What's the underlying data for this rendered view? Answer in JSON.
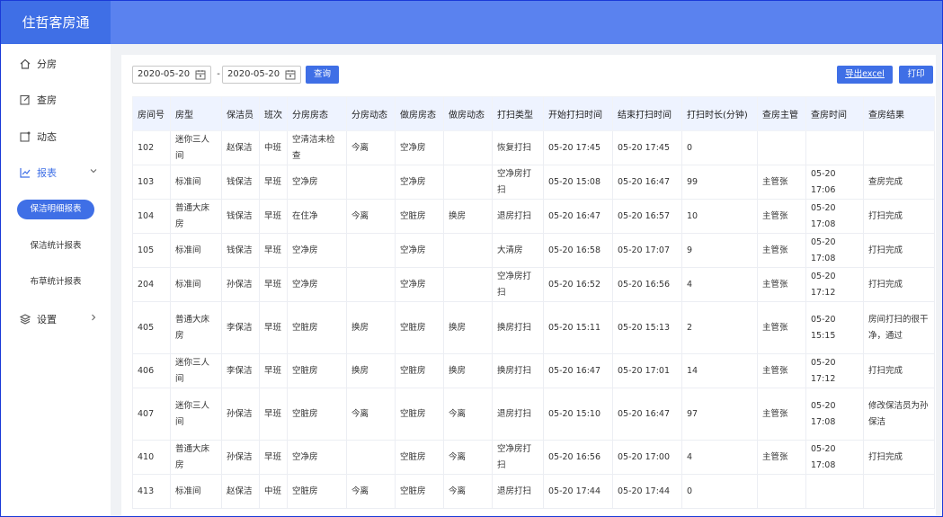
{
  "app": {
    "title": "住哲客房通"
  },
  "sidebar": {
    "items": [
      {
        "label": "分房",
        "icon": "home-icon"
      },
      {
        "label": "查房",
        "icon": "edit-icon"
      },
      {
        "label": "动态",
        "icon": "activity-icon"
      },
      {
        "label": "报表",
        "icon": "chart-icon"
      },
      {
        "label": "设置",
        "icon": "layers-icon"
      }
    ],
    "report_subitems": [
      "保洁明细报表",
      "保洁统计报表",
      "布草统计报表"
    ]
  },
  "filters": {
    "start_date": "2020-05-20",
    "end_date": "2020-05-20",
    "separator": "-",
    "query_label": "查询",
    "export_label": "导出excel",
    "print_label": "打印"
  },
  "table": {
    "columns": [
      "房间号",
      "房型",
      "保洁员",
      "班次",
      "分房房态",
      "分房动态",
      "做房房态",
      "做房动态",
      "打扫类型",
      "开始打扫时间",
      "结束打扫时间",
      "打扫时长(分钟)",
      "查房主管",
      "查房时间",
      "查房结果"
    ],
    "rows": [
      [
        "102",
        "迷你三人间",
        "赵保洁",
        "中班",
        "空清洁未检查",
        "今离",
        "空净房",
        "",
        "恢复打扫",
        "05-20 17:45",
        "05-20 17:45",
        "0",
        "",
        "",
        ""
      ],
      [
        "103",
        "标准间",
        "钱保洁",
        "早班",
        "空净房",
        "",
        "空净房",
        "",
        "空净房打扫",
        "05-20 15:08",
        "05-20 16:47",
        "99",
        "主管张",
        "05-20 17:06",
        "查房完成"
      ],
      [
        "104",
        "普通大床房",
        "钱保洁",
        "早班",
        "在住净",
        "今离",
        "空脏房",
        "换房",
        "退房打扫",
        "05-20 16:47",
        "05-20 16:57",
        "10",
        "主管张",
        "05-20 17:08",
        "打扫完成"
      ],
      [
        "105",
        "标准间",
        "钱保洁",
        "早班",
        "空净房",
        "",
        "空净房",
        "",
        "大清房",
        "05-20 16:58",
        "05-20 17:07",
        "9",
        "主管张",
        "05-20 17:08",
        "打扫完成"
      ],
      [
        "204",
        "标准间",
        "孙保洁",
        "早班",
        "空净房",
        "",
        "空净房",
        "",
        "空净房打扫",
        "05-20 16:52",
        "05-20 16:56",
        "4",
        "主管张",
        "05-20 17:12",
        "打扫完成"
      ],
      [
        "405",
        "普通大床房",
        "李保洁",
        "早班",
        "空脏房",
        "换房",
        "空脏房",
        "换房",
        "换房打扫",
        "05-20 15:11",
        "05-20 15:13",
        "2",
        "主管张",
        "05-20 15:15",
        "房间打扫的很干净，通过"
      ],
      [
        "406",
        "迷你三人间",
        "李保洁",
        "早班",
        "空脏房",
        "换房",
        "空脏房",
        "换房",
        "换房打扫",
        "05-20 16:47",
        "05-20 17:01",
        "14",
        "主管张",
        "05-20 17:12",
        "打扫完成"
      ],
      [
        "407",
        "迷你三人间",
        "孙保洁",
        "早班",
        "空脏房",
        "今离",
        "空脏房",
        "今离",
        "退房打扫",
        "05-20 15:10",
        "05-20 16:47",
        "97",
        "主管张",
        "05-20 17:08",
        "修改保洁员为孙保洁"
      ],
      [
        "410",
        "普通大床房",
        "孙保洁",
        "早班",
        "空净房",
        "",
        "空脏房",
        "今离",
        "空净房打扫",
        "05-20 16:56",
        "05-20 17:00",
        "4",
        "主管张",
        "05-20 17:08",
        "打扫完成"
      ],
      [
        "413",
        "标准间",
        "赵保洁",
        "中班",
        "空脏房",
        "今离",
        "空脏房",
        "今离",
        "退房打扫",
        "05-20 17:44",
        "05-20 17:44",
        "0",
        "",
        "",
        ""
      ]
    ]
  }
}
